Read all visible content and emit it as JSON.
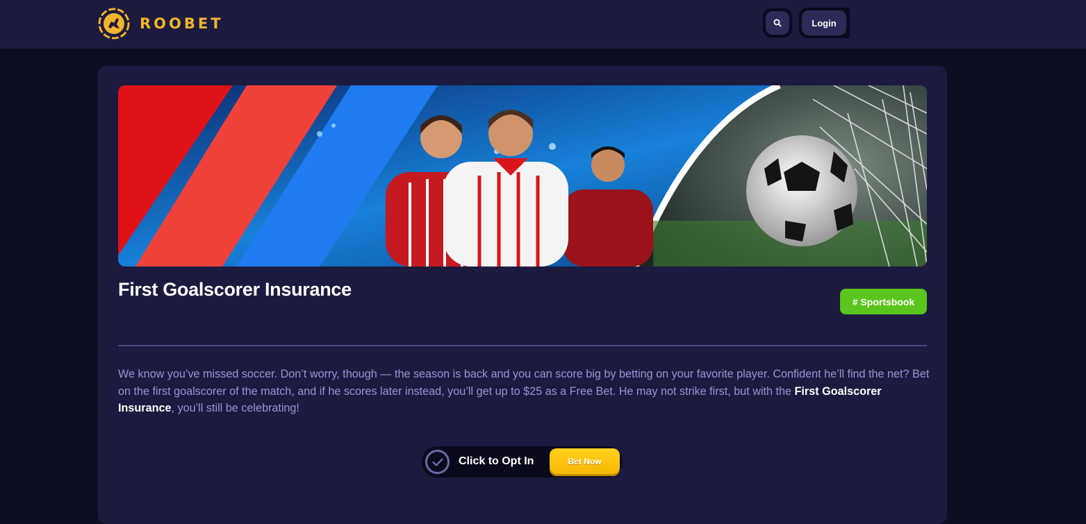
{
  "header": {
    "brand": "ROOBET",
    "login_label": "Login",
    "icons": [
      "roobet-logo-icon",
      "search-icon"
    ]
  },
  "promo": {
    "title": "First Goalscorer Insurance",
    "tag": "# Sportsbook",
    "description_pre": "We know you’ve missed soccer. Don’t worry, though — the season is back and you can score big by betting on your favorite player. Confident he’ll find the net? Bet on the first goalscorer of the match, and if he scores later instead, you’ll get up to $25 as a Free Bet. He may not strike first, but with the ",
    "description_bold": "First Goalscorer Insurance",
    "description_post": ", you’ll still be celebrating!",
    "optin_label": "Click to Opt In",
    "bet_now_label": "Bet Now"
  },
  "colors": {
    "topbar": "#1c1a3e",
    "page_bg": "#0e0e22",
    "brand_gold": "#f2b42c",
    "tag_green": "#5ac51c",
    "button_yellow": "#ffd21f",
    "text_muted": "#9e93d6"
  }
}
